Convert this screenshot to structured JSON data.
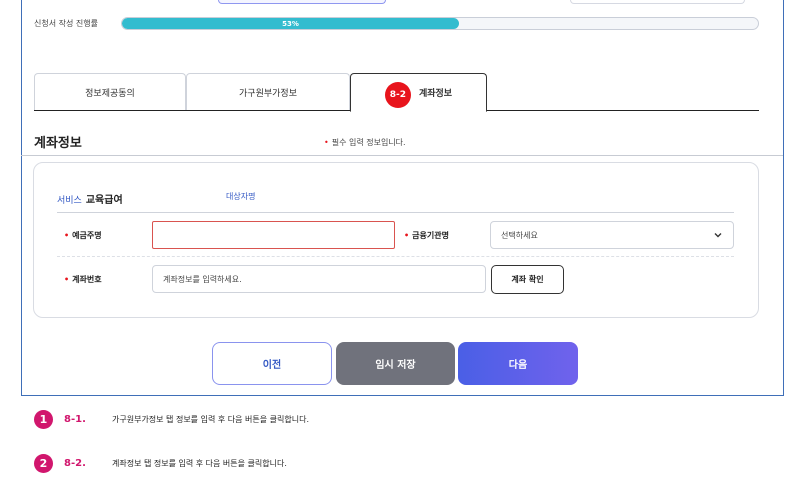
{
  "progress": {
    "label": "신청서 작성 진행률",
    "percent_text": "53%",
    "value": 0.53
  },
  "tabs": [
    {
      "label": "정보제공동의"
    },
    {
      "label": "가구원부가정보"
    },
    {
      "badge": "8-2",
      "label": "계좌정보"
    }
  ],
  "section": {
    "title": "계좌정보",
    "required_note": "필수 입력 정보입니다."
  },
  "card": {
    "service_prefix": "서비스",
    "service_name": "교육급여",
    "target_label": "대상자명",
    "fields": {
      "holder_label": "예금주명",
      "holder_value": "",
      "bank_label": "금융기관명",
      "bank_selected": "선택하세요",
      "account_label": "계좌번호",
      "account_placeholder": "계좌정보를 입력하세요.",
      "confirm_button": "계좌 확인"
    }
  },
  "buttons": {
    "prev": "이전",
    "temp_save": "임시 저장",
    "next": "다음"
  },
  "notes": [
    {
      "num": "1",
      "step": "8-1.",
      "text": "가구원부가정보 탭 정보를 입력 후 다음 버튼을 클릭합니다."
    },
    {
      "num": "2",
      "step": "8-2.",
      "text": "계좌정보 탭 정보를 입력 후 다음 버튼을 클릭합니다."
    }
  ],
  "colors": {
    "progress": "#33bccf",
    "required": "#e8141c",
    "accent": "#3459c4",
    "note": "#d1166d"
  },
  "icons": {
    "bank_select": "chevron-down-icon"
  }
}
